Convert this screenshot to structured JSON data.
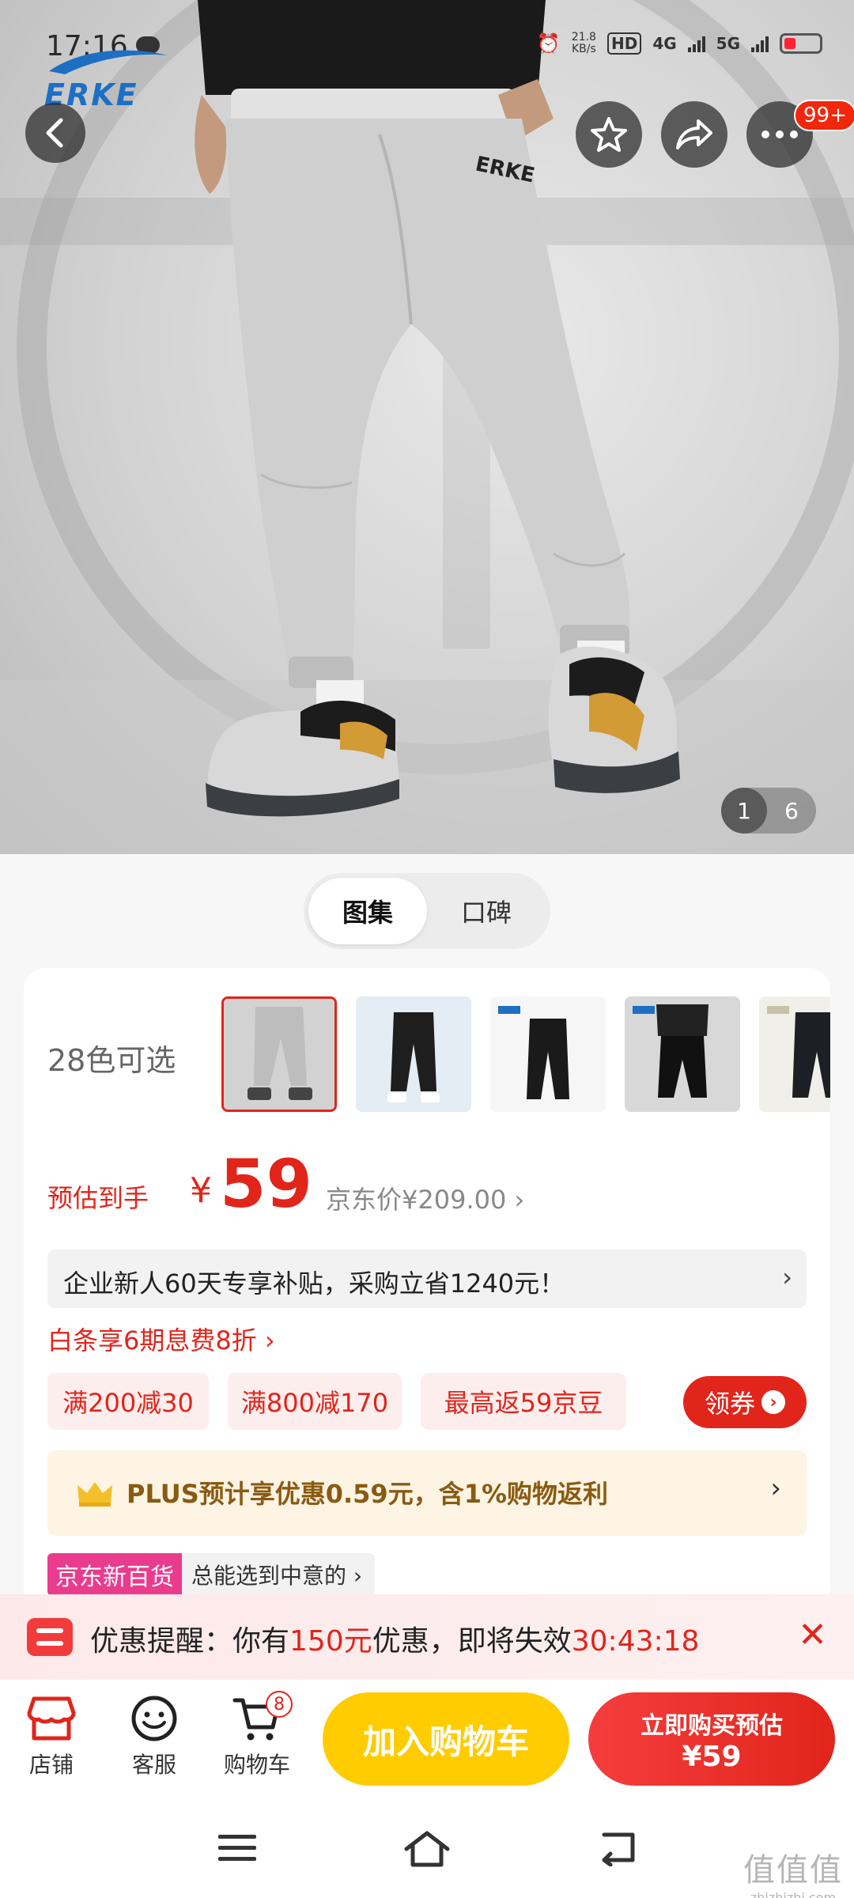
{
  "status_bar": {
    "time": "17:16",
    "net_speed": "21.8",
    "net_speed_unit": "KB/s",
    "hd_badge": "HD",
    "net_4g": "4G",
    "net_5g": "5G"
  },
  "brand": {
    "logo_text": "ERKE"
  },
  "top_actions": {
    "more_badge": "99+"
  },
  "gallery": {
    "current": "1",
    "total": "6"
  },
  "segment": {
    "tabs": [
      "图集",
      "口碑"
    ],
    "active": 0
  },
  "color_picker": {
    "label": "28色可选"
  },
  "price": {
    "label": "预估到手",
    "currency": "¥",
    "value": "59",
    "jd_price": "京东价¥209.00 ›"
  },
  "enterprise_banner": {
    "text": "企业新人60天专享补贴，采购立省1240元！",
    "arrow": "›"
  },
  "baitiao": {
    "text": "白条享6期息费8折 ›"
  },
  "coupons": {
    "items": [
      "满200减30",
      "满800减170",
      "最高返59京豆"
    ],
    "claim_label": "领券",
    "claim_arrow": "›"
  },
  "plus": {
    "text": "PLUS预计享优惠0.59元，含1%购物返利",
    "arrow": "›"
  },
  "jd_new": {
    "tag": "京东新百货",
    "text": "总能选到中意的 ›"
  },
  "reminder": {
    "prefix": "优惠提醒：你有",
    "amount": "150元",
    "middle": "优惠，即将失效",
    "countdown": "30:43:18",
    "close": "✕"
  },
  "bottom_bar": {
    "store_label": "店铺",
    "service_label": "客服",
    "cart_label": "购物车",
    "cart_count": "8",
    "add_to_cart": "加入购物车",
    "buy_line1": "立即购买预估",
    "buy_line2": "¥59"
  },
  "watermark": {
    "logo": "值值值",
    "url": "zhizhizhi.com"
  },
  "colors": {
    "accent_red": "#e1251b",
    "add_cart_yellow": "#ffcc00",
    "brand_blue": "#1d6fc4",
    "plus_gold": "#8a5a12"
  }
}
